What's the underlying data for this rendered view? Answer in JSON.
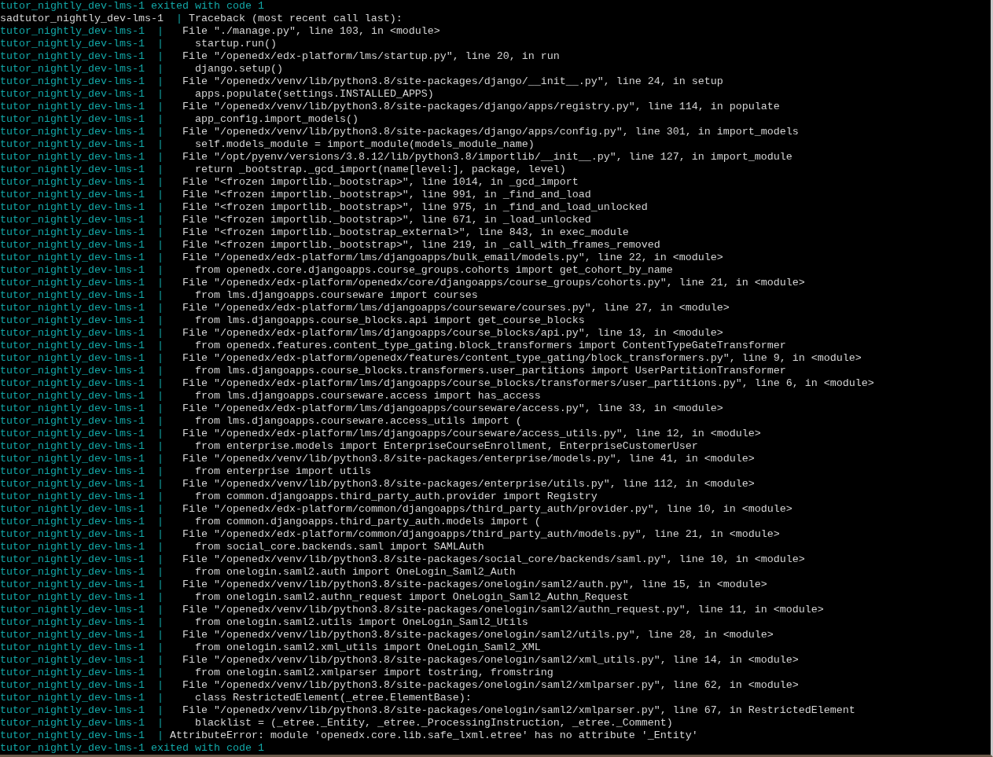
{
  "terminal": {
    "lines": [
      {
        "kind": "exit",
        "source": "tutor_nightly_dev-lms-1",
        "message": "exited with code 1"
      },
      {
        "kind": "header",
        "source": "sadtutor_nightly_dev-lms-1",
        "separator": "|",
        "message": "Traceback (most recent call last):"
      },
      {
        "kind": "file",
        "source": "tutor_nightly_dev-lms-1",
        "separator": "|",
        "message": "File \"./manage.py\", line 103, in <module>"
      },
      {
        "kind": "code",
        "source": "tutor_nightly_dev-lms-1",
        "separator": "|",
        "message": "startup.run()"
      },
      {
        "kind": "file",
        "source": "tutor_nightly_dev-lms-1",
        "separator": "|",
        "message": "File \"/openedx/edx-platform/lms/startup.py\", line 20, in run"
      },
      {
        "kind": "code",
        "source": "tutor_nightly_dev-lms-1",
        "separator": "|",
        "message": "django.setup()"
      },
      {
        "kind": "file",
        "source": "tutor_nightly_dev-lms-1",
        "separator": "|",
        "message": "File \"/openedx/venv/lib/python3.8/site-packages/django/__init__.py\", line 24, in setup"
      },
      {
        "kind": "code",
        "source": "tutor_nightly_dev-lms-1",
        "separator": "|",
        "message": "apps.populate(settings.INSTALLED_APPS)"
      },
      {
        "kind": "file",
        "source": "tutor_nightly_dev-lms-1",
        "separator": "|",
        "message": "File \"/openedx/venv/lib/python3.8/site-packages/django/apps/registry.py\", line 114, in populate"
      },
      {
        "kind": "code",
        "source": "tutor_nightly_dev-lms-1",
        "separator": "|",
        "message": "app_config.import_models()"
      },
      {
        "kind": "file",
        "source": "tutor_nightly_dev-lms-1",
        "separator": "|",
        "message": "File \"/openedx/venv/lib/python3.8/site-packages/django/apps/config.py\", line 301, in import_models"
      },
      {
        "kind": "code",
        "source": "tutor_nightly_dev-lms-1",
        "separator": "|",
        "message": "self.models_module = import_module(models_module_name)"
      },
      {
        "kind": "file",
        "source": "tutor_nightly_dev-lms-1",
        "separator": "|",
        "message": "File \"/opt/pyenv/versions/3.8.12/lib/python3.8/importlib/__init__.py\", line 127, in import_module"
      },
      {
        "kind": "code",
        "source": "tutor_nightly_dev-lms-1",
        "separator": "|",
        "message": "return _bootstrap._gcd_import(name[level:], package, level)"
      },
      {
        "kind": "file",
        "source": "tutor_nightly_dev-lms-1",
        "separator": "|",
        "message": "File \"<frozen importlib._bootstrap>\", line 1014, in _gcd_import"
      },
      {
        "kind": "file",
        "source": "tutor_nightly_dev-lms-1",
        "separator": "|",
        "message": "File \"<frozen importlib._bootstrap>\", line 991, in _find_and_load"
      },
      {
        "kind": "file",
        "source": "tutor_nightly_dev-lms-1",
        "separator": "|",
        "message": "File \"<frozen importlib._bootstrap>\", line 975, in _find_and_load_unlocked"
      },
      {
        "kind": "file",
        "source": "tutor_nightly_dev-lms-1",
        "separator": "|",
        "message": "File \"<frozen importlib._bootstrap>\", line 671, in _load_unlocked"
      },
      {
        "kind": "file",
        "source": "tutor_nightly_dev-lms-1",
        "separator": "|",
        "message": "File \"<frozen importlib._bootstrap_external>\", line 843, in exec_module"
      },
      {
        "kind": "file",
        "source": "tutor_nightly_dev-lms-1",
        "separator": "|",
        "message": "File \"<frozen importlib._bootstrap>\", line 219, in _call_with_frames_removed"
      },
      {
        "kind": "file",
        "source": "tutor_nightly_dev-lms-1",
        "separator": "|",
        "message": "File \"/openedx/edx-platform/lms/djangoapps/bulk_email/models.py\", line 22, in <module>"
      },
      {
        "kind": "code",
        "source": "tutor_nightly_dev-lms-1",
        "separator": "|",
        "message": "from openedx.core.djangoapps.course_groups.cohorts import get_cohort_by_name"
      },
      {
        "kind": "file",
        "source": "tutor_nightly_dev-lms-1",
        "separator": "|",
        "message": "File \"/openedx/edx-platform/openedx/core/djangoapps/course_groups/cohorts.py\", line 21, in <module>"
      },
      {
        "kind": "code",
        "source": "tutor_nightly_dev-lms-1",
        "separator": "|",
        "message": "from lms.djangoapps.courseware import courses"
      },
      {
        "kind": "file",
        "source": "tutor_nightly_dev-lms-1",
        "separator": "|",
        "message": "File \"/openedx/edx-platform/lms/djangoapps/courseware/courses.py\", line 27, in <module>"
      },
      {
        "kind": "code",
        "source": "tutor_nightly_dev-lms-1",
        "separator": "|",
        "message": "from lms.djangoapps.course_blocks.api import get_course_blocks"
      },
      {
        "kind": "file",
        "source": "tutor_nightly_dev-lms-1",
        "separator": "|",
        "message": "File \"/openedx/edx-platform/lms/djangoapps/course_blocks/api.py\", line 13, in <module>"
      },
      {
        "kind": "code",
        "source": "tutor_nightly_dev-lms-1",
        "separator": "|",
        "message": "from openedx.features.content_type_gating.block_transformers import ContentTypeGateTransformer"
      },
      {
        "kind": "file",
        "source": "tutor_nightly_dev-lms-1",
        "separator": "|",
        "message": "File \"/openedx/edx-platform/openedx/features/content_type_gating/block_transformers.py\", line 9, in <module>"
      },
      {
        "kind": "code",
        "source": "tutor_nightly_dev-lms-1",
        "separator": "|",
        "message": "from lms.djangoapps.course_blocks.transformers.user_partitions import UserPartitionTransformer"
      },
      {
        "kind": "file",
        "source": "tutor_nightly_dev-lms-1",
        "separator": "|",
        "message": "File \"/openedx/edx-platform/lms/djangoapps/course_blocks/transformers/user_partitions.py\", line 6, in <module>"
      },
      {
        "kind": "code",
        "source": "tutor_nightly_dev-lms-1",
        "separator": "|",
        "message": "from lms.djangoapps.courseware.access import has_access"
      },
      {
        "kind": "file",
        "source": "tutor_nightly_dev-lms-1",
        "separator": "|",
        "message": "File \"/openedx/edx-platform/lms/djangoapps/courseware/access.py\", line 33, in <module>"
      },
      {
        "kind": "code",
        "source": "tutor_nightly_dev-lms-1",
        "separator": "|",
        "message": "from lms.djangoapps.courseware.access_utils import ("
      },
      {
        "kind": "file",
        "source": "tutor_nightly_dev-lms-1",
        "separator": "|",
        "message": "File \"/openedx/edx-platform/lms/djangoapps/courseware/access_utils.py\", line 12, in <module>"
      },
      {
        "kind": "code",
        "source": "tutor_nightly_dev-lms-1",
        "separator": "|",
        "message": "from enterprise.models import EnterpriseCourseEnrollment, EnterpriseCustomerUser"
      },
      {
        "kind": "file",
        "source": "tutor_nightly_dev-lms-1",
        "separator": "|",
        "message": "File \"/openedx/venv/lib/python3.8/site-packages/enterprise/models.py\", line 41, in <module>"
      },
      {
        "kind": "code",
        "source": "tutor_nightly_dev-lms-1",
        "separator": "|",
        "message": "from enterprise import utils"
      },
      {
        "kind": "file",
        "source": "tutor_nightly_dev-lms-1",
        "separator": "|",
        "message": "File \"/openedx/venv/lib/python3.8/site-packages/enterprise/utils.py\", line 112, in <module>"
      },
      {
        "kind": "code",
        "source": "tutor_nightly_dev-lms-1",
        "separator": "|",
        "message": "from common.djangoapps.third_party_auth.provider import Registry"
      },
      {
        "kind": "file",
        "source": "tutor_nightly_dev-lms-1",
        "separator": "|",
        "message": "File \"/openedx/edx-platform/common/djangoapps/third_party_auth/provider.py\", line 10, in <module>"
      },
      {
        "kind": "code",
        "source": "tutor_nightly_dev-lms-1",
        "separator": "|",
        "message": "from common.djangoapps.third_party_auth.models import ("
      },
      {
        "kind": "file",
        "source": "tutor_nightly_dev-lms-1",
        "separator": "|",
        "message": "File \"/openedx/edx-platform/common/djangoapps/third_party_auth/models.py\", line 21, in <module>"
      },
      {
        "kind": "code",
        "source": "tutor_nightly_dev-lms-1",
        "separator": "|",
        "message": "from social_core.backends.saml import SAMLAuth"
      },
      {
        "kind": "file",
        "source": "tutor_nightly_dev-lms-1",
        "separator": "|",
        "message": "File \"/openedx/venv/lib/python3.8/site-packages/social_core/backends/saml.py\", line 10, in <module>"
      },
      {
        "kind": "code",
        "source": "tutor_nightly_dev-lms-1",
        "separator": "|",
        "message": "from onelogin.saml2.auth import OneLogin_Saml2_Auth"
      },
      {
        "kind": "file",
        "source": "tutor_nightly_dev-lms-1",
        "separator": "|",
        "message": "File \"/openedx/venv/lib/python3.8/site-packages/onelogin/saml2/auth.py\", line 15, in <module>"
      },
      {
        "kind": "code",
        "source": "tutor_nightly_dev-lms-1",
        "separator": "|",
        "message": "from onelogin.saml2.authn_request import OneLogin_Saml2_Authn_Request"
      },
      {
        "kind": "file",
        "source": "tutor_nightly_dev-lms-1",
        "separator": "|",
        "message": "File \"/openedx/venv/lib/python3.8/site-packages/onelogin/saml2/authn_request.py\", line 11, in <module>"
      },
      {
        "kind": "code",
        "source": "tutor_nightly_dev-lms-1",
        "separator": "|",
        "message": "from onelogin.saml2.utils import OneLogin_Saml2_Utils"
      },
      {
        "kind": "file",
        "source": "tutor_nightly_dev-lms-1",
        "separator": "|",
        "message": "File \"/openedx/venv/lib/python3.8/site-packages/onelogin/saml2/utils.py\", line 28, in <module>"
      },
      {
        "kind": "code",
        "source": "tutor_nightly_dev-lms-1",
        "separator": "|",
        "message": "from onelogin.saml2.xml_utils import OneLogin_Saml2_XML"
      },
      {
        "kind": "file",
        "source": "tutor_nightly_dev-lms-1",
        "separator": "|",
        "message": "File \"/openedx/venv/lib/python3.8/site-packages/onelogin/saml2/xml_utils.py\", line 14, in <module>"
      },
      {
        "kind": "code",
        "source": "tutor_nightly_dev-lms-1",
        "separator": "|",
        "message": "from onelogin.saml2.xmlparser import tostring, fromstring"
      },
      {
        "kind": "file",
        "source": "tutor_nightly_dev-lms-1",
        "separator": "|",
        "message": "File \"/openedx/venv/lib/python3.8/site-packages/onelogin/saml2/xmlparser.py\", line 62, in <module>"
      },
      {
        "kind": "code",
        "source": "tutor_nightly_dev-lms-1",
        "separator": "|",
        "message": "class RestrictedElement(_etree.ElementBase):"
      },
      {
        "kind": "file",
        "source": "tutor_nightly_dev-lms-1",
        "separator": "|",
        "message": "File \"/openedx/venv/lib/python3.8/site-packages/onelogin/saml2/xmlparser.py\", line 67, in RestrictedElement"
      },
      {
        "kind": "code",
        "source": "tutor_nightly_dev-lms-1",
        "separator": "|",
        "message": "blacklist = (_etree._Entity, _etree._ProcessingInstruction, _etree._Comment)"
      },
      {
        "kind": "error",
        "source": "tutor_nightly_dev-lms-1",
        "separator": "|",
        "message": "AttributeError: module 'openedx.core.lib.safe_lxml.etree' has no attribute '_Entity'"
      },
      {
        "kind": "exit",
        "source": "tutor_nightly_dev-lms-1",
        "message": "exited with code 1"
      }
    ]
  }
}
